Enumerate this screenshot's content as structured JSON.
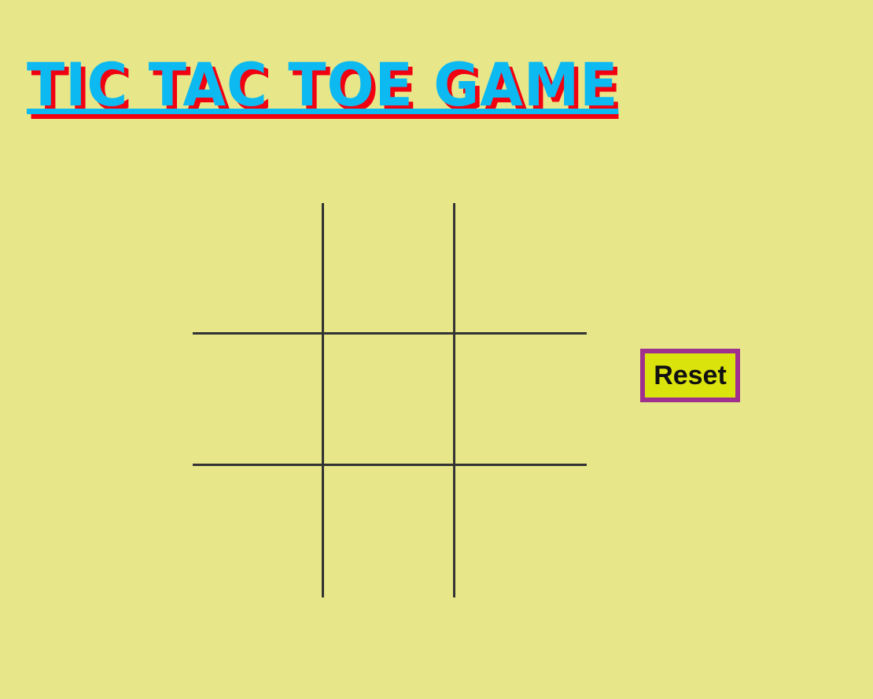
{
  "page": {
    "title": "TIC TAC TOE GAME"
  },
  "board": {
    "cells": [
      "",
      "",
      "",
      "",
      "",
      "",
      "",
      "",
      ""
    ]
  },
  "controls": {
    "reset_label": "Reset"
  },
  "colors": {
    "background": "#e7e78a",
    "title_fill": "#0cb9f1",
    "title_shadow": "#f00010",
    "grid_lines": "#333333",
    "reset_background": "#dbe30d",
    "reset_border": "#a0308e"
  }
}
